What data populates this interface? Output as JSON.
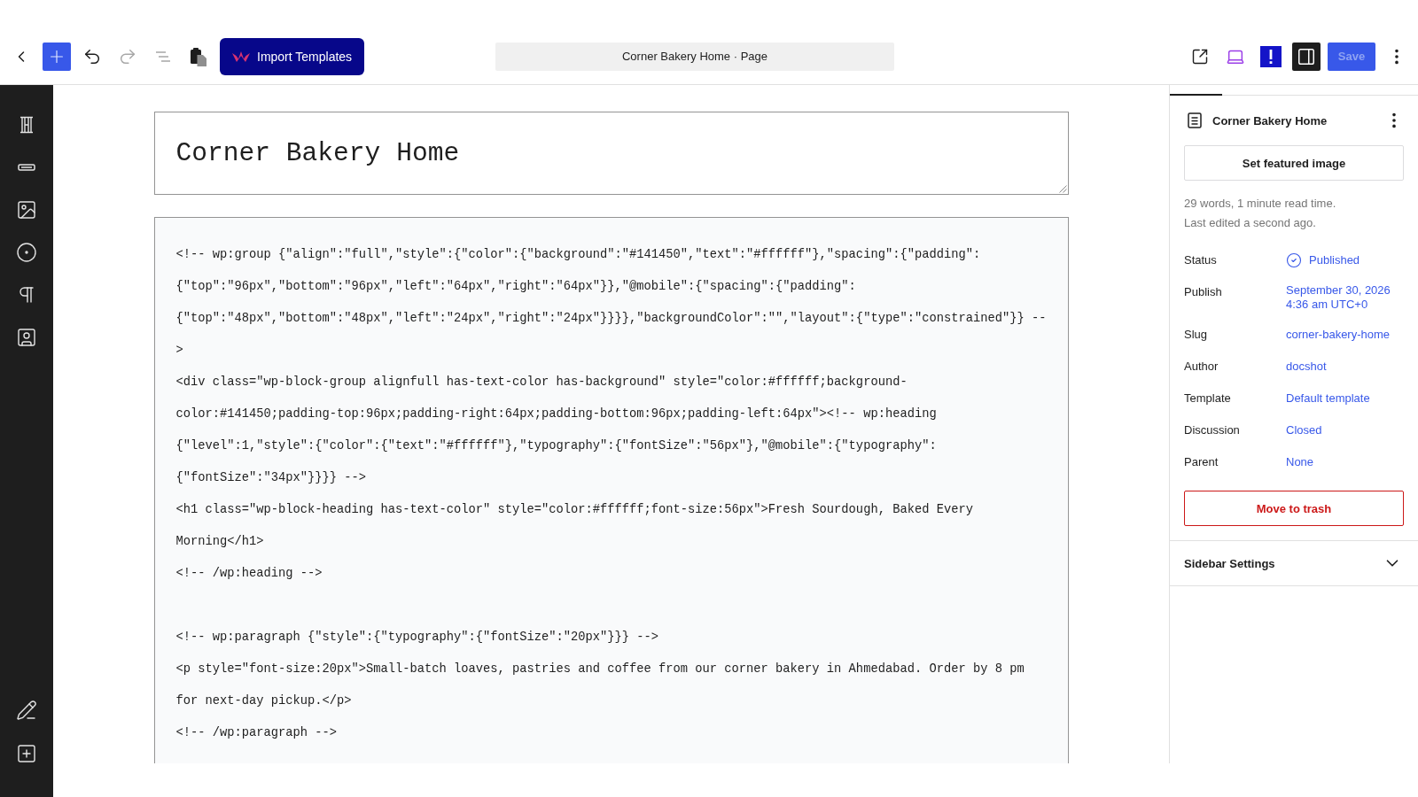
{
  "toolbar": {
    "undo": {
      "disabled": false
    },
    "redo": {
      "disabled": true
    },
    "list_view": {
      "disabled": true
    },
    "import_button": "Import Templates",
    "document_title": "Corner Bakery Home · Page",
    "settings_toggle": {
      "pressed": true
    },
    "save": {
      "label": "Save",
      "disabled": true
    }
  },
  "editor": {
    "title": "Corner Bakery Home",
    "code_blocks": [
      [
        "<!-- wp:group {\"align\":\"full\",\"style\":{\"color\":{\"background\":\"#141450\",\"text\":\"#ffffff\"},\"spacing\":{\"padding\":",
        "{\"top\":\"96px\",\"bottom\":\"96px\",\"left\":\"64px\",\"right\":\"64px\"}},\"@mobile\":{\"spacing\":{\"padding\":",
        "{\"top\":\"48px\",\"bottom\":\"48px\",\"left\":\"24px\",\"right\":\"24px\"}}}},\"backgroundColor\":\"\",\"layout\":{\"type\":\"constrained\"}} --",
        ">",
        "<div class=\"wp-block-group alignfull has-text-color has-background\" style=\"color:#ffffff;background-",
        "color:#141450;padding-top:96px;padding-right:64px;padding-bottom:96px;padding-left:64px\"><!-- wp:heading",
        "{\"level\":1,\"style\":{\"color\":{\"text\":\"#ffffff\"},\"typography\":{\"fontSize\":\"56px\"},\"@mobile\":{\"typography\":",
        "{\"fontSize\":\"34px\"}}}} -->",
        "<h1 class=\"wp-block-heading has-text-color\" style=\"color:#ffffff;font-size:56px\">Fresh Sourdough, Baked Every",
        "Morning</h1>",
        "<!-- /wp:heading -->"
      ],
      [
        "<!-- wp:paragraph {\"style\":{\"typography\":{\"fontSize\":\"20px\"}}} -->",
        "<p style=\"font-size:20px\">Small-batch loaves, pastries and coffee from our corner bakery in Ahmedabad. Order by 8 pm",
        "for next-day pickup.</p>",
        "<!-- /wp:paragraph -->"
      ]
    ]
  },
  "settings_panel": {
    "page_title": "Corner Bakery Home",
    "featured_image_button": "Set featured image",
    "stats": [
      "29 words, 1 minute read time.",
      "Last edited a second ago."
    ],
    "rows": [
      {
        "kind": "status",
        "label": "Status",
        "value": "Published"
      },
      {
        "kind": "link",
        "label": "Publish",
        "value": "September 30, 2026 4:36 am UTC+0"
      },
      {
        "kind": "link",
        "label": "Slug",
        "value": "corner-bakery-home"
      },
      {
        "kind": "link",
        "label": "Author",
        "value": "docshot"
      },
      {
        "kind": "link",
        "label": "Template",
        "value": "Default template"
      },
      {
        "kind": "link",
        "label": "Discussion",
        "value": "Closed"
      },
      {
        "kind": "link",
        "label": "Parent",
        "value": "None"
      }
    ],
    "trash_button": "Move to trash",
    "sections": [
      {
        "title": "Sidebar Settings",
        "expanded": false
      }
    ]
  }
}
